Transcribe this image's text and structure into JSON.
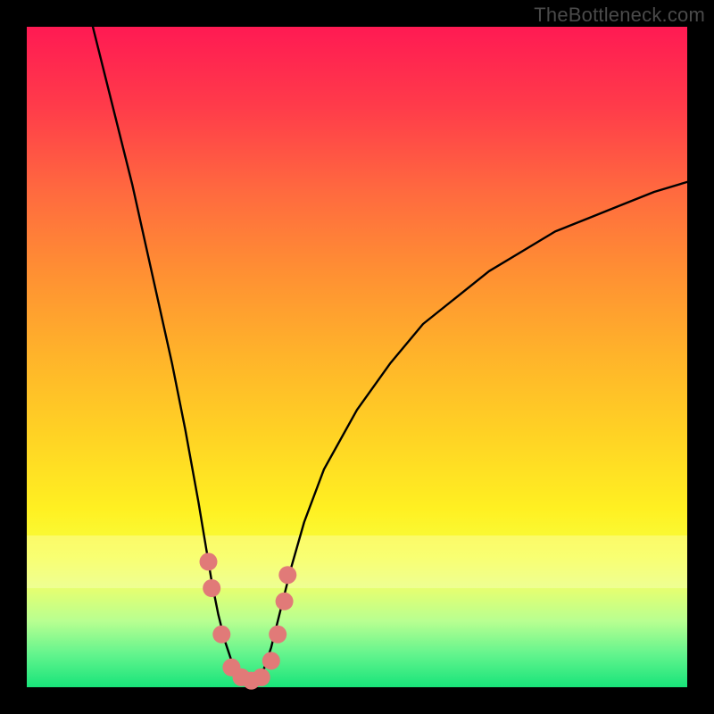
{
  "watermark": "TheBottleneck.com",
  "chart_data": {
    "type": "line",
    "title": "",
    "xlabel": "",
    "ylabel": "",
    "xlim": [
      0,
      100
    ],
    "ylim": [
      0,
      100
    ],
    "grid": false,
    "series": [
      {
        "name": "left-branch",
        "x": [
          10,
          12,
          14,
          16,
          18,
          20,
          22,
          24,
          26,
          27,
          28,
          29,
          30,
          31,
          32,
          33,
          34
        ],
        "y": [
          100,
          92,
          84,
          76,
          67,
          58,
          49,
          39,
          28,
          22,
          16,
          11,
          7,
          4,
          2,
          1,
          0
        ]
      },
      {
        "name": "right-branch",
        "x": [
          34,
          35,
          36,
          37,
          38,
          39,
          40,
          42,
          45,
          50,
          55,
          60,
          65,
          70,
          75,
          80,
          85,
          90,
          95,
          100
        ],
        "y": [
          0,
          1,
          3,
          6,
          10,
          14,
          18,
          25,
          33,
          42,
          49,
          55,
          59,
          63,
          66,
          69,
          71,
          73,
          75,
          76.5
        ]
      }
    ],
    "markers": {
      "name": "bottom-dots",
      "color": "#e17a78",
      "points": [
        {
          "x": 27.5,
          "y": 19
        },
        {
          "x": 28.0,
          "y": 15
        },
        {
          "x": 29.5,
          "y": 8
        },
        {
          "x": 31.0,
          "y": 3
        },
        {
          "x": 32.5,
          "y": 1.5
        },
        {
          "x": 34.0,
          "y": 1
        },
        {
          "x": 35.5,
          "y": 1.5
        },
        {
          "x": 37.0,
          "y": 4
        },
        {
          "x": 38.0,
          "y": 8
        },
        {
          "x": 39.0,
          "y": 13
        },
        {
          "x": 39.5,
          "y": 17
        }
      ]
    },
    "background_gradient": {
      "top": "#ff1a53",
      "bottom": "#18e47a"
    }
  }
}
